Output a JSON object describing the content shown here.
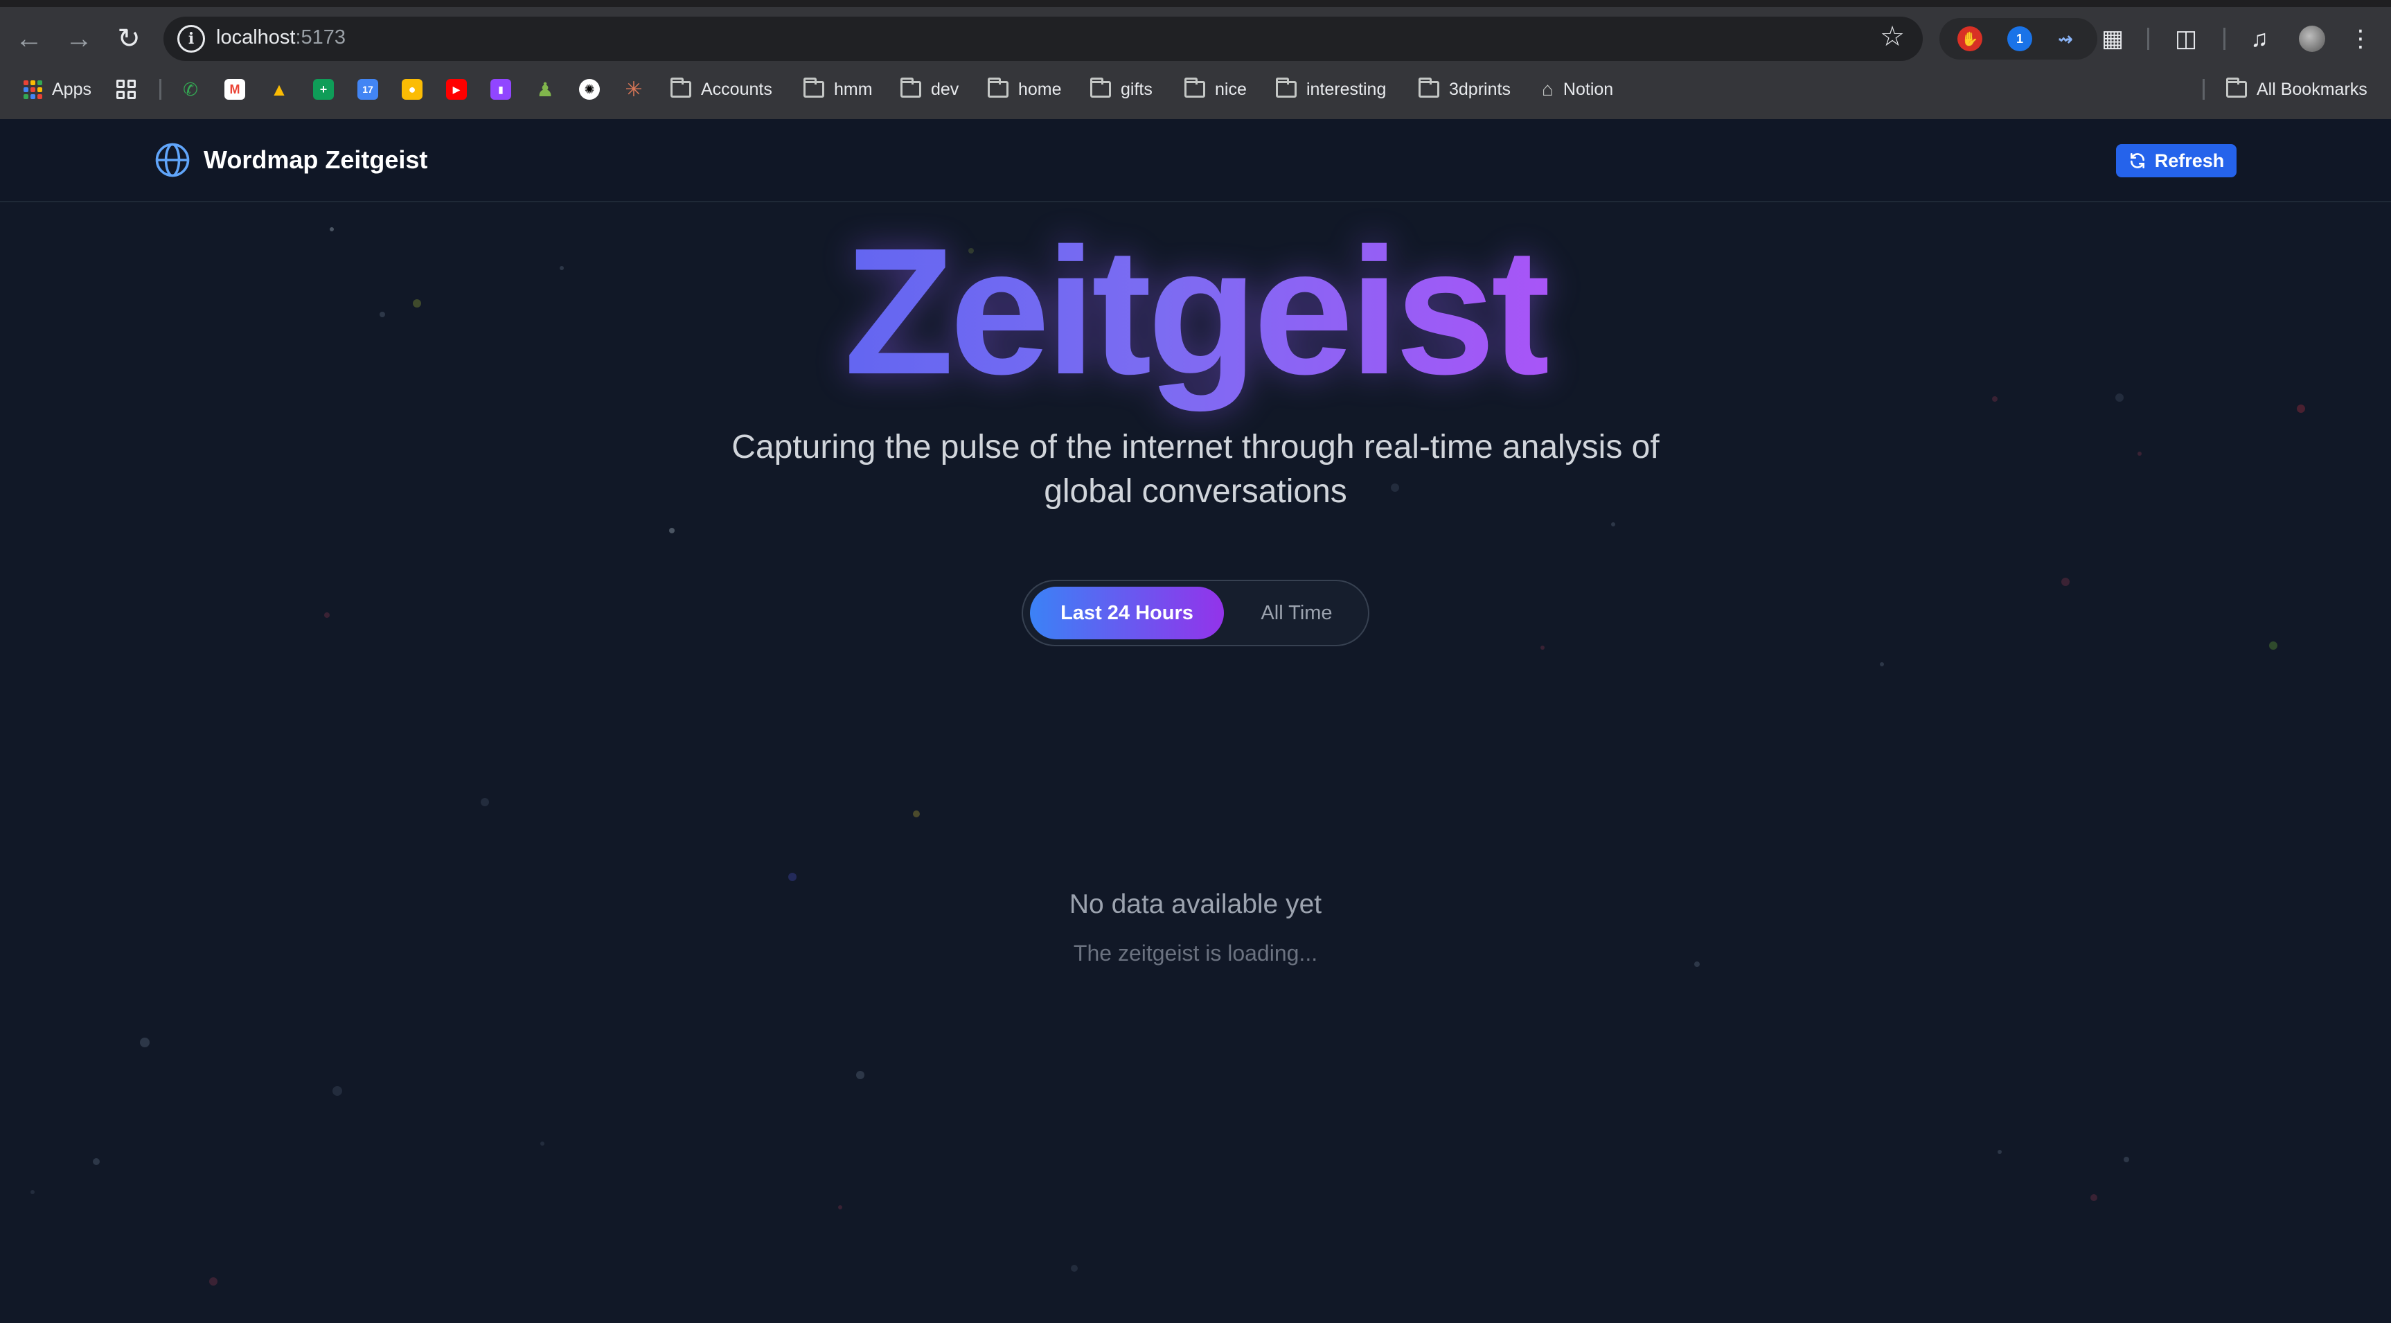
{
  "browser": {
    "url_host": "localhost",
    "url_port": ":5173",
    "bookmarks": {
      "apps": "Apps",
      "folders": [
        "Accounts",
        "hmm",
        "dev",
        "home",
        "gifts",
        "nice",
        "interesting",
        "3dprints"
      ],
      "notion": "Notion",
      "all_bookmarks": "All Bookmarks"
    }
  },
  "header": {
    "brand": "Wordmap Zeitgeist",
    "refresh_label": "Refresh"
  },
  "hero": {
    "title": "Zeitgeist",
    "subtitle": "Capturing the pulse of the internet through real-time analysis of global conversations"
  },
  "time_range": {
    "options": [
      "Last 24 Hours",
      "All Time"
    ],
    "selected": "Last 24 Hours"
  },
  "empty_state": {
    "title": "No data available yet",
    "message": "The zeitgeist is loading..."
  },
  "colors": {
    "background": "#111827",
    "accent_blue": "#2563eb",
    "gradient_start": "#6366f1",
    "gradient_end": "#a855f7"
  }
}
